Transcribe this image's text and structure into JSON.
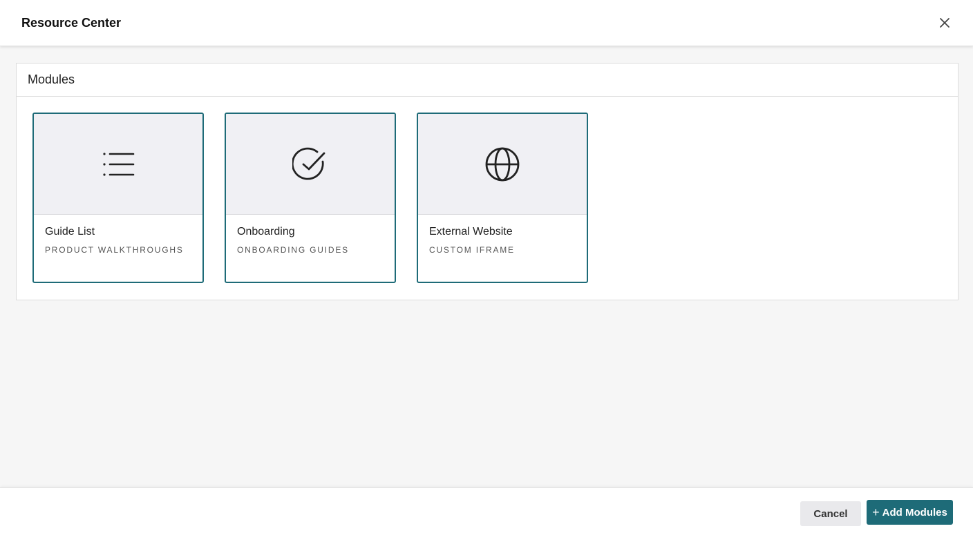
{
  "header": {
    "title": "Resource Center",
    "close_icon": "close-icon"
  },
  "panel": {
    "title": "Modules",
    "cards": [
      {
        "title": "Guide List",
        "subtitle": "PRODUCT WALKTHROUGHS",
        "icon": "list-icon"
      },
      {
        "title": "Onboarding",
        "subtitle": "ONBOARDING GUIDES",
        "icon": "check-circle-icon"
      },
      {
        "title": "External Website",
        "subtitle": "CUSTOM IFRAME",
        "icon": "globe-icon"
      }
    ]
  },
  "footer": {
    "cancel_label": "Cancel",
    "add_label": "Add Modules",
    "add_icon": "plus-icon"
  },
  "colors": {
    "accent": "#1e6b78",
    "background": "#f6f6f6",
    "card_icon_bg": "#f0f0f4"
  }
}
